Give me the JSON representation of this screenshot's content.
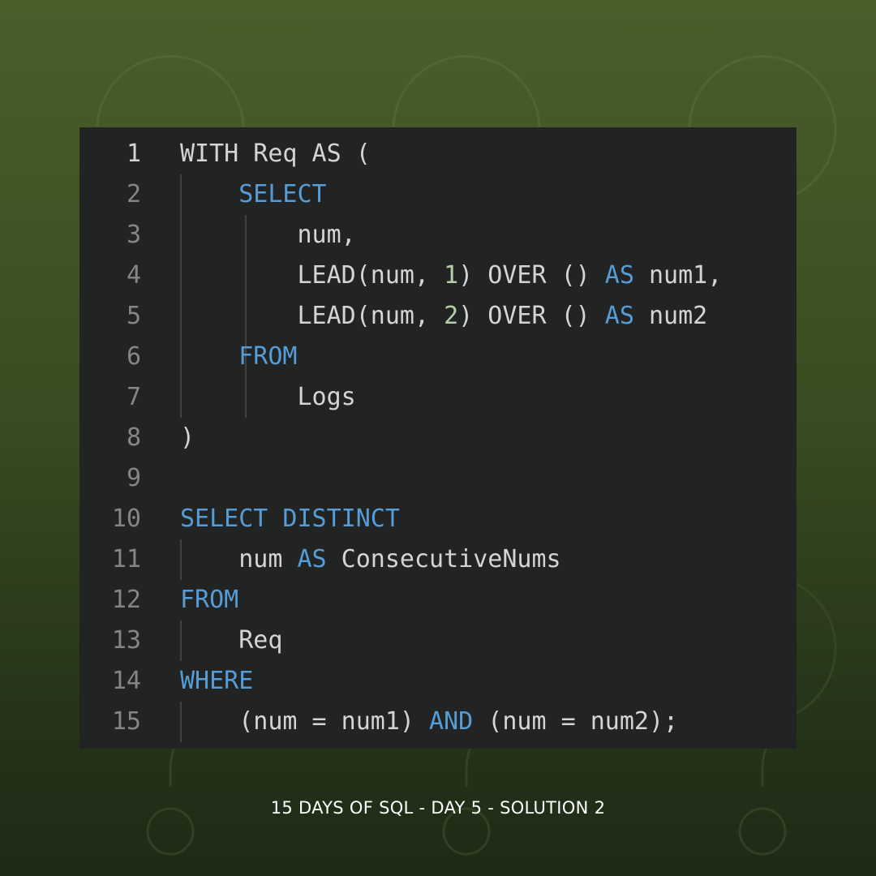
{
  "editor": {
    "lines": [
      {
        "number": "1",
        "tokens": [
          {
            "t": "WITH Req AS (",
            "c": "plain"
          }
        ]
      },
      {
        "number": "2",
        "tokens": [
          {
            "t": "    ",
            "c": "plain"
          },
          {
            "t": "SELECT",
            "c": "kw"
          }
        ]
      },
      {
        "number": "3",
        "tokens": [
          {
            "t": "        num,",
            "c": "plain"
          }
        ]
      },
      {
        "number": "4",
        "tokens": [
          {
            "t": "        LEAD(num, ",
            "c": "plain"
          },
          {
            "t": "1",
            "c": "num"
          },
          {
            "t": ") OVER () ",
            "c": "plain"
          },
          {
            "t": "AS",
            "c": "kw"
          },
          {
            "t": " num1,",
            "c": "plain"
          }
        ]
      },
      {
        "number": "5",
        "tokens": [
          {
            "t": "        LEAD(num, ",
            "c": "plain"
          },
          {
            "t": "2",
            "c": "num"
          },
          {
            "t": ") OVER () ",
            "c": "plain"
          },
          {
            "t": "AS",
            "c": "kw"
          },
          {
            "t": " num2",
            "c": "plain"
          }
        ]
      },
      {
        "number": "6",
        "tokens": [
          {
            "t": "    ",
            "c": "plain"
          },
          {
            "t": "FROM",
            "c": "kw"
          }
        ]
      },
      {
        "number": "7",
        "tokens": [
          {
            "t": "        Logs",
            "c": "plain"
          }
        ]
      },
      {
        "number": "8",
        "tokens": [
          {
            "t": ")",
            "c": "plain"
          }
        ]
      },
      {
        "number": "9",
        "tokens": []
      },
      {
        "number": "10",
        "tokens": [
          {
            "t": "SELECT DISTINCT",
            "c": "kw"
          }
        ]
      },
      {
        "number": "11",
        "tokens": [
          {
            "t": "    num ",
            "c": "plain"
          },
          {
            "t": "AS",
            "c": "kw"
          },
          {
            "t": " ConsecutiveNums",
            "c": "plain"
          }
        ]
      },
      {
        "number": "12",
        "tokens": [
          {
            "t": "FROM",
            "c": "kw"
          }
        ]
      },
      {
        "number": "13",
        "tokens": [
          {
            "t": "    Req",
            "c": "plain"
          }
        ]
      },
      {
        "number": "14",
        "tokens": [
          {
            "t": "WHERE",
            "c": "kw"
          }
        ]
      },
      {
        "number": "15",
        "tokens": [
          {
            "t": "    (num = num1) ",
            "c": "plain"
          },
          {
            "t": "AND",
            "c": "kw"
          },
          {
            "t": " (num = num2);",
            "c": "plain"
          }
        ]
      }
    ],
    "active_line": "1",
    "colors": {
      "background": "#222323",
      "keyword": "#569cd6",
      "number": "#b5cea8",
      "text": "#d4d4d4",
      "line_number": "#858585"
    }
  },
  "caption": "15 DAYS OF SQL - DAY 5 - SOLUTION 2"
}
